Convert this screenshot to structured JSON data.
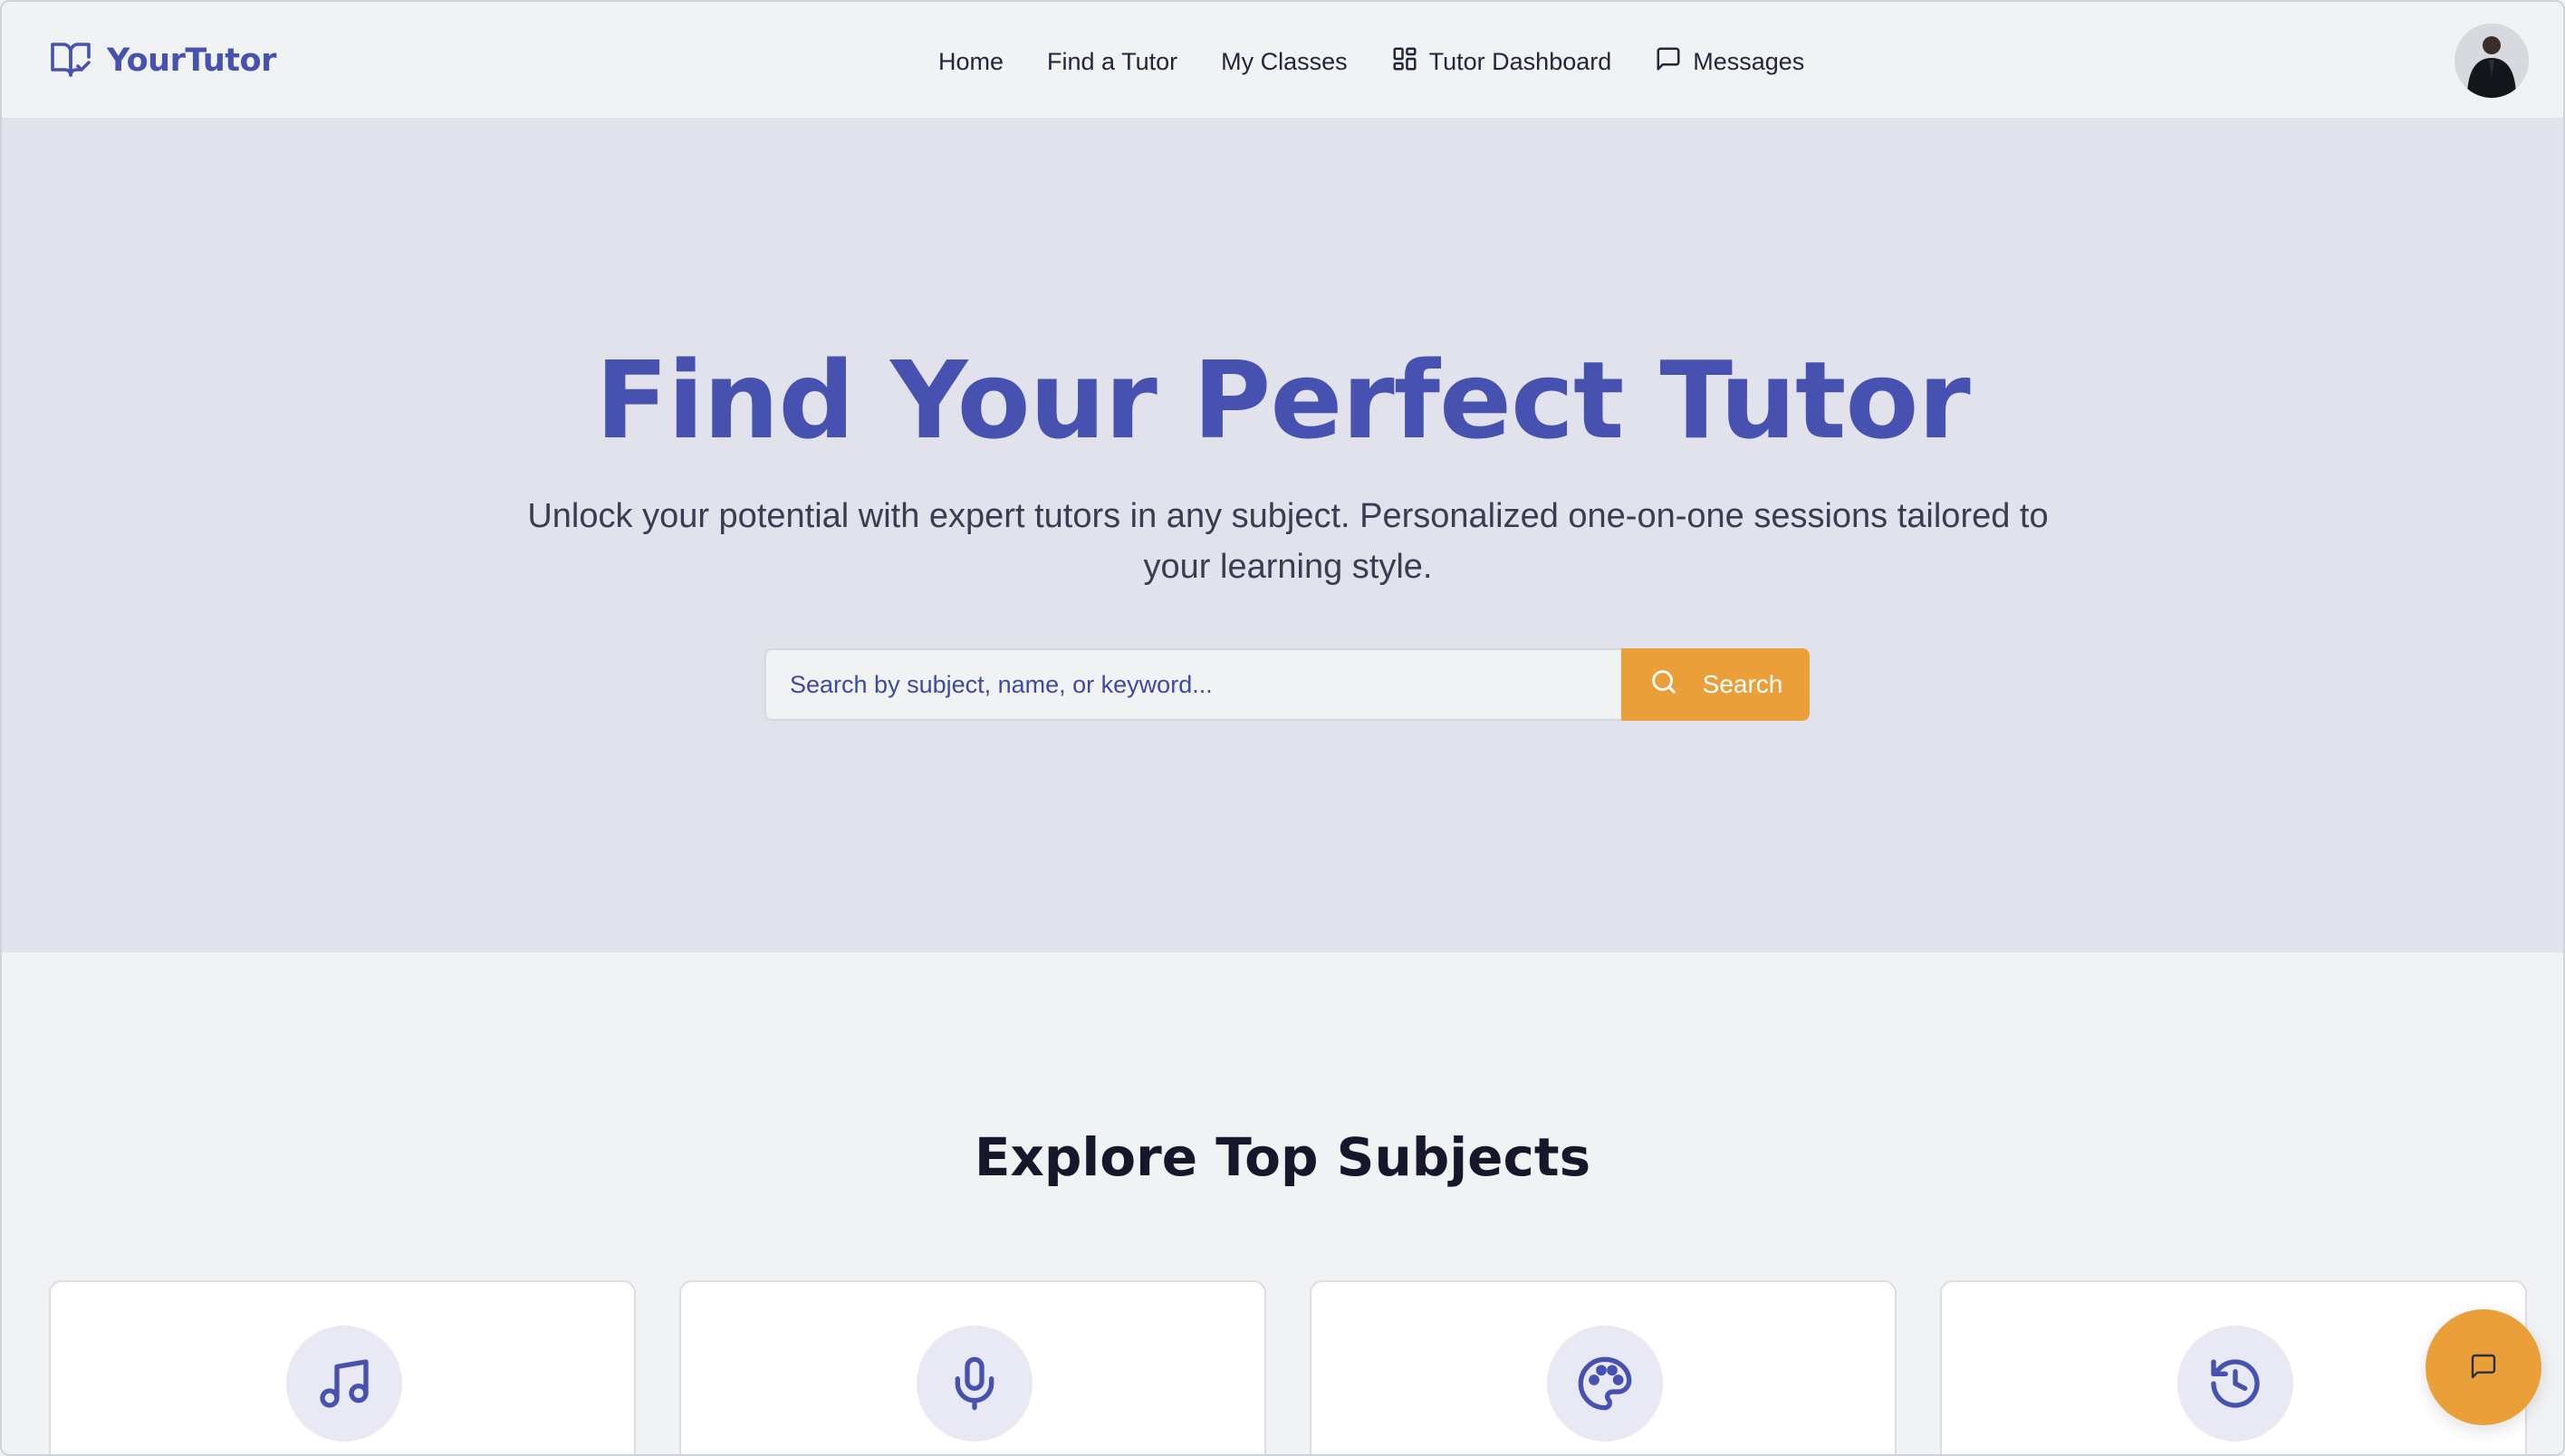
{
  "header": {
    "brand_name": "YourTutor",
    "brand_icon": "book-check-icon",
    "nav": [
      {
        "label": "Home"
      },
      {
        "label": "Find a Tutor"
      },
      {
        "label": "My Classes"
      },
      {
        "label": "Tutor Dashboard",
        "icon": "dashboard-icon"
      },
      {
        "label": "Messages",
        "icon": "message-icon"
      }
    ],
    "avatar_icon": "user-avatar"
  },
  "hero": {
    "title": "Find Your Perfect Tutor",
    "subtitle": "Unlock your potential with expert tutors in any subject. Personalized one-on-one sessions tailored to your learning style.",
    "search_placeholder": "Search by subject, name, or keyword...",
    "search_value": "",
    "search_button": "Search"
  },
  "subjects": {
    "title": "Explore Top Subjects",
    "cards": [
      {
        "icon": "music-icon"
      },
      {
        "icon": "microphone-icon"
      },
      {
        "icon": "palette-icon"
      },
      {
        "icon": "history-icon"
      }
    ]
  },
  "chat_fab": {
    "icon": "chat-icon"
  },
  "colors": {
    "brand": "#4651b0",
    "accent": "#eb9f38",
    "hero_bg": "#e1e2ec",
    "page_bg": "#f1f2f4"
  }
}
